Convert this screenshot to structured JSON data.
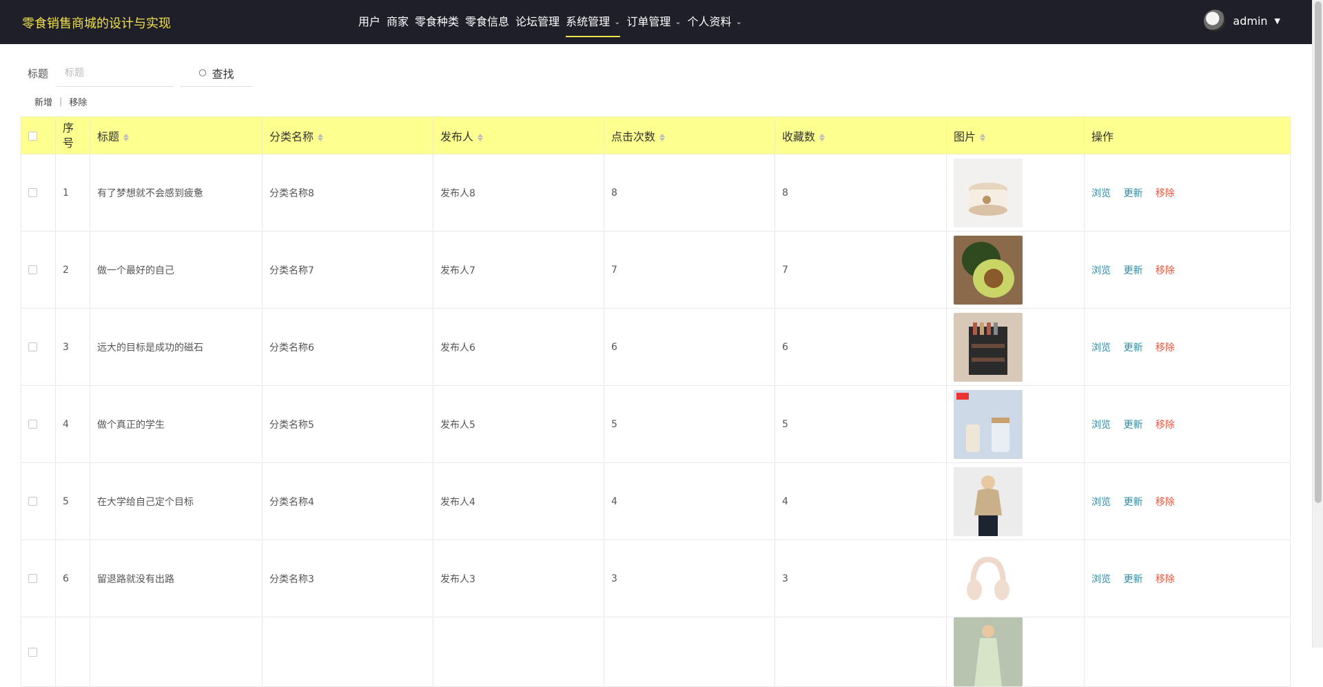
{
  "app": {
    "brand": "零食销售商城的设计与实现"
  },
  "nav": {
    "items": [
      {
        "label": "用户",
        "dropdown": false,
        "active": false
      },
      {
        "label": "商家",
        "dropdown": false,
        "active": false
      },
      {
        "label": "零食种类",
        "dropdown": false,
        "active": false
      },
      {
        "label": "零食信息",
        "dropdown": false,
        "active": false
      },
      {
        "label": "论坛管理",
        "dropdown": false,
        "active": false
      },
      {
        "label": "系统管理",
        "dropdown": true,
        "active": true
      },
      {
        "label": "订单管理",
        "dropdown": true,
        "active": false
      },
      {
        "label": "个人资料",
        "dropdown": true,
        "active": false
      }
    ]
  },
  "user": {
    "name": "admin"
  },
  "search": {
    "label": "标题",
    "placeholder": "标题",
    "value": "",
    "button": "查找"
  },
  "actions": {
    "add": "新增",
    "remove": "移除"
  },
  "table": {
    "headers": {
      "index": "序号",
      "title": "标题",
      "category": "分类名称",
      "publisher": "发布人",
      "clicks": "点击次数",
      "favorites": "收藏数",
      "image": "图片",
      "operation": "操作"
    },
    "op_labels": {
      "browse": "浏览",
      "update": "更新",
      "remove": "移除"
    },
    "rows": [
      {
        "index": "1",
        "title": "有了梦想就不会感到疲惫",
        "category": "分类名称8",
        "publisher": "发布人8",
        "clicks": "8",
        "favorites": "8",
        "image": "cream-jar"
      },
      {
        "index": "2",
        "title": "做一个最好的自己",
        "category": "分类名称7",
        "publisher": "发布人7",
        "clicks": "7",
        "favorites": "7",
        "image": "avocado"
      },
      {
        "index": "3",
        "title": "远大的目标是成功的磁石",
        "category": "分类名称6",
        "publisher": "发布人6",
        "clicks": "6",
        "favorites": "6",
        "image": "spice-rack"
      },
      {
        "index": "4",
        "title": "做个真正的学生",
        "category": "分类名称5",
        "publisher": "发布人5",
        "clicks": "5",
        "favorites": "5",
        "image": "baby-bottle"
      },
      {
        "index": "5",
        "title": "在大学给自己定个目标",
        "category": "分类名称4",
        "publisher": "发布人4",
        "clicks": "4",
        "favorites": "4",
        "image": "fashion-model"
      },
      {
        "index": "6",
        "title": "留退路就没有出路",
        "category": "分类名称3",
        "publisher": "发布人3",
        "clicks": "3",
        "favorites": "3",
        "image": "headphones"
      },
      {
        "index": "",
        "title": "",
        "category": "",
        "publisher": "",
        "clicks": "",
        "favorites": "",
        "image": "dress-model"
      }
    ]
  },
  "colors": {
    "topbar": "#1f1f2a",
    "brand": "#f0e04a",
    "header_row": "#fdff8f",
    "link": "#2e8ba6",
    "danger": "#e9573f"
  }
}
